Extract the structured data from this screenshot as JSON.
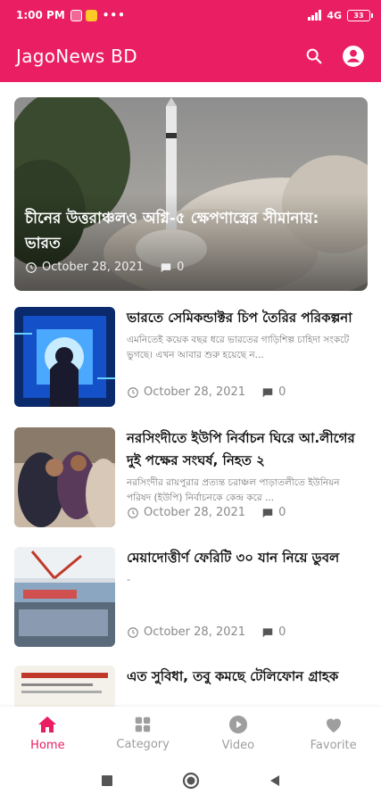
{
  "status_bar": {
    "time": "1:00 PM",
    "network": "4G",
    "battery": "33"
  },
  "app_bar": {
    "title": "JagoNews BD",
    "icons": [
      "search-icon",
      "account-icon"
    ]
  },
  "feed": {
    "featured": {
      "title": "চীনের উত্তরাঞ্চলও অগ্নি-৫ ক্ষেপণাস্ত্রের সীমানায়: ভারত",
      "date": "October 28, 2021",
      "comments": "0"
    },
    "articles": [
      {
        "title": "ভারতে সেমিকন্ডাক্টর চিপ তৈরির পরিকল্পনা",
        "excerpt": "এমনিতেই কয়েক বছর ধরে ভারতের গাড়িশিল্প চাহিদা সংকটে ভুগছে। এখন আবার শুরু হয়েছে ন...",
        "date": "October 28, 2021",
        "comments": "0"
      },
      {
        "title": "নরসিংদীতে ইউপি নির্বাচন ঘিরে আ.লীগের দুই পক্ষের সংঘর্ষ, নিহত ২",
        "excerpt": "নরসিংদীর রায়পুরার প্রত্যন্ত চরাঞ্চল পাড়াতলীতে ইউনিয়ন পরিষদ (ইউপি) নির্বাচনকে কেন্দ্র করে ...",
        "date": "October 28, 2021",
        "comments": "0"
      },
      {
        "title": "মেয়াদোত্তীর্ণ ফেরিটি ৩০ যান নিয়ে ডুবল",
        "excerpt": "-",
        "date": "October 28, 2021",
        "comments": "0"
      },
      {
        "title": "এত সুবিধা, তবু কমছে টেলিফোন গ্রাহক",
        "excerpt": "",
        "date": "",
        "comments": ""
      }
    ]
  },
  "bottom_nav": {
    "items": [
      {
        "label": "Home",
        "icon": "home-icon",
        "active": true
      },
      {
        "label": "Category",
        "icon": "category-icon",
        "active": false
      },
      {
        "label": "Video",
        "icon": "video-icon",
        "active": false
      },
      {
        "label": "Favorite",
        "icon": "heart-icon",
        "active": false
      }
    ]
  },
  "colors": {
    "primary": "#e91e63",
    "inactive": "#9e9e9e",
    "meta_text": "#8a8a8a"
  }
}
